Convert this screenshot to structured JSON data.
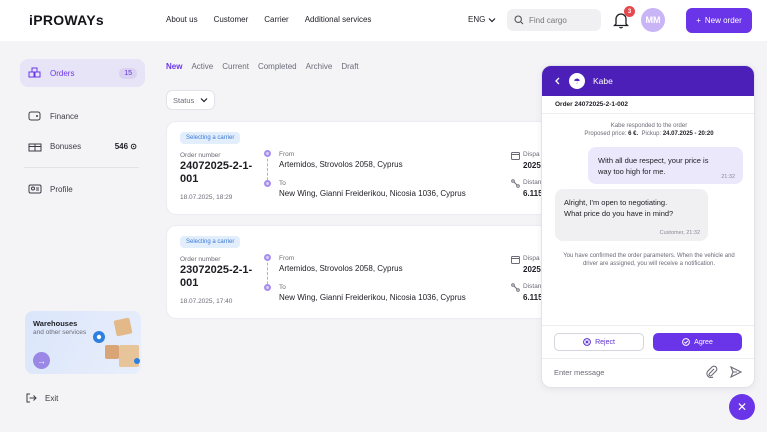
{
  "header": {
    "logo": "iPROWAYs",
    "nav": [
      "About us",
      "Customer",
      "Carrier",
      "Additional services"
    ],
    "language": "ENG",
    "search_placeholder": "Find cargo",
    "notifications_count": "3",
    "avatar_initials": "MM",
    "new_order_label": "New order"
  },
  "sidebar": {
    "orders_label": "Orders",
    "orders_count": "15",
    "finance_label": "Finance",
    "bonuses_label": "Bonuses",
    "bonuses_value": "546",
    "profile_label": "Profile",
    "promo_title": "Warehouses",
    "promo_subtitle": "and other services",
    "exit_label": "Exit"
  },
  "tabs": [
    "New",
    "Active",
    "Current",
    "Completed",
    "Archive",
    "Draft"
  ],
  "active_tab": "New",
  "status_filter": "Status",
  "orders": [
    {
      "badge": "Selecting a carrier",
      "order_number_label": "Order number",
      "order_number": "24072025-2-1-001",
      "created": "18.07.2025, 18:29",
      "from_label": "From",
      "from": "Artemidos, Strovolos 2058, Cyprus",
      "to_label": "To",
      "to": "New Wing, Gianni Freiderikou, Nicosia 1036, Cyprus",
      "dispatch_label": "Dispa",
      "dispatch_value": "2025.",
      "distance_label": "Distan",
      "distance_value": "6.115"
    },
    {
      "badge": "Selecting a carrier",
      "order_number_label": "Order number",
      "order_number": "23072025-2-1-001",
      "created": "18.07.2025, 17:40",
      "from_label": "From",
      "from": "Artemidos, Strovolos 2058, Cyprus",
      "to_label": "To",
      "to": "New Wing, Gianni Freiderikou, Nicosia 1036, Cyprus",
      "dispatch_label": "Dispa",
      "dispatch_value": "2025.",
      "distance_label": "Distan",
      "distance_value": "6.115"
    }
  ],
  "chat": {
    "contact_name": "Kabe",
    "order_title": "Order 24072025-2-1-002",
    "system_response": "Kabe responded to the order",
    "proposed_price_label": "Proposed price:",
    "proposed_price": "6 €.",
    "pickup_label": "Pickup:",
    "pickup": "24.07.2025 - 20:20",
    "msg_out_text": "With all due respect, your price is way too high for me.",
    "msg_out_time": "21:32",
    "msg_in_text": "Alright, I'm open to negotiating. What price do you have in mind?",
    "msg_in_meta": "Customer, 21:32",
    "system_confirm": "You have confirmed the order parameters. When the vehicle and driver are assigned, you will receive a notification.",
    "reject_label": "Reject",
    "agree_label": "Agree",
    "input_placeholder": "Enter message"
  },
  "colors": {
    "accent": "#6a35e8",
    "chat_header": "#4b1fb8",
    "badge_bg": "#e3eefc",
    "badge_text": "#3a79d8"
  }
}
